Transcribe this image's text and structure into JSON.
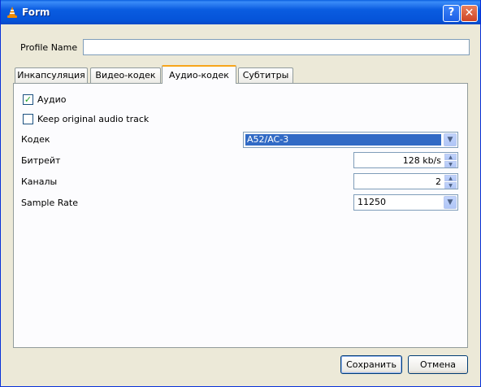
{
  "window": {
    "title": "Form"
  },
  "profile": {
    "label": "Profile Name",
    "value": ""
  },
  "tabs": [
    {
      "label": "Инкапсуляция"
    },
    {
      "label": "Видео-кодек"
    },
    {
      "label": "Аудио-кодек",
      "active": true
    },
    {
      "label": "Субтитры"
    }
  ],
  "audio": {
    "enable_label": "Аудио",
    "enable_checked": true,
    "keep_label": "Keep original audio track",
    "keep_checked": false,
    "codec_label": "Кодек",
    "codec_value": "A52/AC-3",
    "bitrate_label": "Битрейт",
    "bitrate_value": "128 kb/s",
    "channels_label": "Каналы",
    "channels_value": "2",
    "samplerate_label": "Sample Rate",
    "samplerate_value": "11250"
  },
  "buttons": {
    "save": "Сохранить",
    "cancel": "Отмена"
  },
  "icons": {
    "app": "vlc-cone-icon",
    "help": "help-icon",
    "close": "close-icon",
    "dropdown": "chevron-down-icon",
    "spin_up": "spin-up-icon",
    "spin_down": "spin-down-icon",
    "check": "checkmark-icon"
  }
}
